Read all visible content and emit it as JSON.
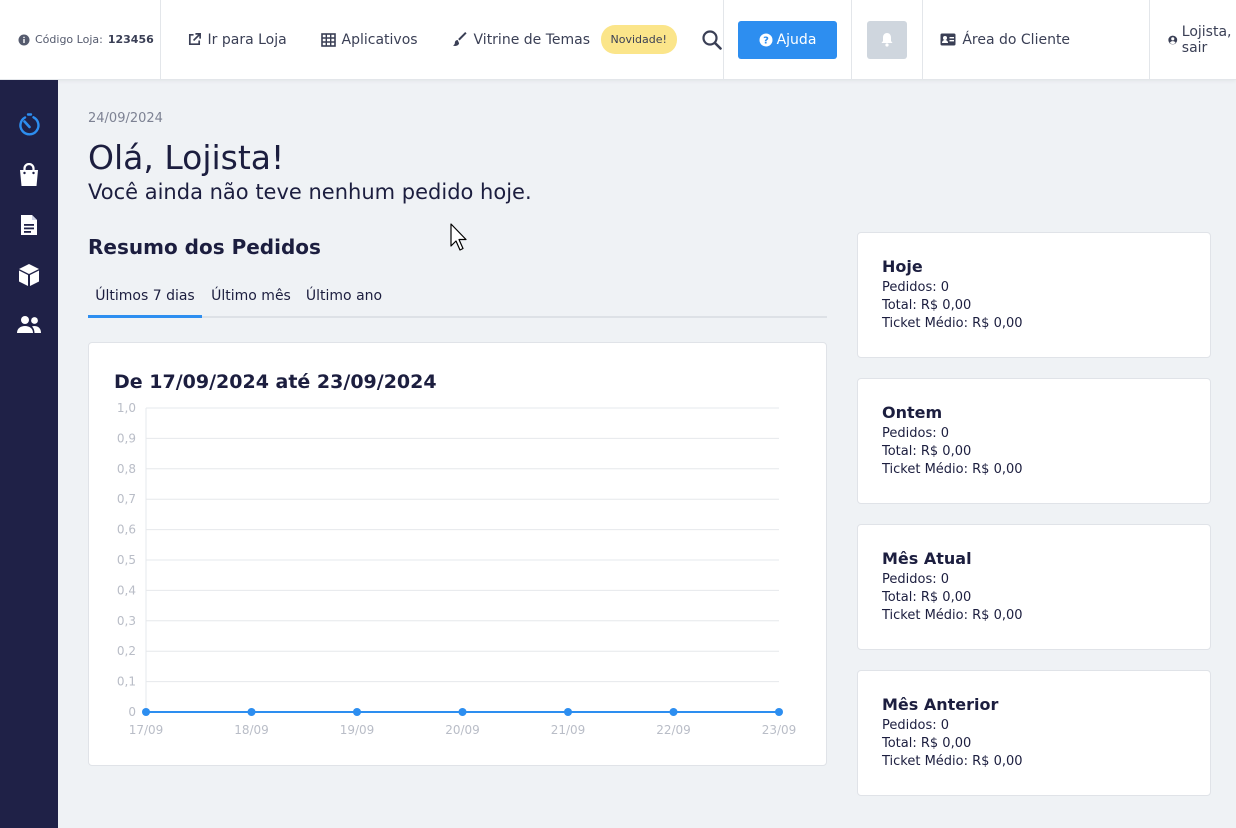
{
  "header": {
    "store_code_label": "Código Loja:",
    "store_code_value": "123456",
    "links": {
      "go_store": "Ir para Loja",
      "apps": "Aplicativos",
      "themes": "Vitrine de Temas",
      "new_badge": "Novidade!"
    },
    "help_label": "Ajuda",
    "client_area_label": "Área do Cliente",
    "logout_label": "Lojista, sair"
  },
  "sidebar": {
    "items": [
      "dashboard-icon",
      "shopping-bag-icon",
      "document-icon",
      "box-icon",
      "users-icon"
    ]
  },
  "main": {
    "date": "24/09/2024",
    "greeting": "Olá, Lojista!",
    "subtitle": "Você ainda não teve nenhum pedido hoje.",
    "section_title": "Resumo dos Pedidos",
    "tabs": [
      {
        "label": "Últimos 7 dias"
      },
      {
        "label": "Último mês"
      },
      {
        "label": "Último ano"
      }
    ]
  },
  "chart_data": {
    "type": "line",
    "title": "De 17/09/2024 até 23/09/2024",
    "categories": [
      "17/09",
      "18/09",
      "19/09",
      "20/09",
      "21/09",
      "22/09",
      "23/09"
    ],
    "values": [
      0,
      0,
      0,
      0,
      0,
      0,
      0
    ],
    "ylim": [
      0,
      1.0
    ],
    "yticks": [
      "0",
      "0,1",
      "0,2",
      "0,3",
      "0,4",
      "0,5",
      "0,6",
      "0,7",
      "0,8",
      "0,9",
      "1,0"
    ],
    "grid": true,
    "color": "#2d8ef0"
  },
  "stats": [
    {
      "title": "Hoje",
      "orders": "Pedidos: 0",
      "total": "Total: R$ 0,00",
      "ticket": "Ticket Médio: R$ 0,00"
    },
    {
      "title": "Ontem",
      "orders": "Pedidos: 0",
      "total": "Total: R$ 0,00",
      "ticket": "Ticket Médio: R$ 0,00"
    },
    {
      "title": "Mês Atual",
      "orders": "Pedidos: 0",
      "total": "Total: R$ 0,00",
      "ticket": "Ticket Médio: R$ 0,00"
    },
    {
      "title": "Mês Anterior",
      "orders": "Pedidos: 0",
      "total": "Total: R$ 0,00",
      "ticket": "Ticket Médio: R$ 0,00"
    }
  ],
  "colors": {
    "accent": "#2d8ef0",
    "sidebar": "#1f2147",
    "badge": "#fbe58a"
  }
}
